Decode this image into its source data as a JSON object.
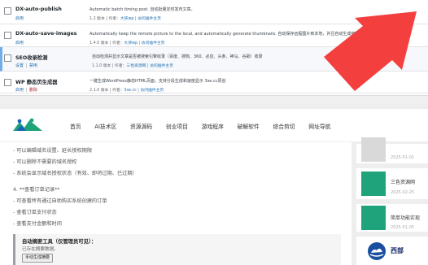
{
  "plugins": [
    {
      "name": "DX-auto-publish",
      "actions": [
        "启用"
      ],
      "description": "Automatic batch timing post. 自动批量定时发布文章。",
      "version": "1.2 版本",
      "author_prefix": "作者：",
      "author": "大侠wp",
      "details": "访问插件主页"
    },
    {
      "name": "DX-auto-save-images",
      "actions": [
        "启用"
      ],
      "description": "Automatically keep the remote picture to the local, and automatically generate thumbnails. 自动保存远程图片到本地，并且自动生成缩略图。",
      "version": "1.4.0 版本",
      "author_prefix": "作者：",
      "author": "大侠wp",
      "details": "访问插件主页"
    },
    {
      "name": "SEO收录检测",
      "actions": [
        "设置",
        "禁用"
      ],
      "description": "自动检测并显示文章是否被搜索引擎收录（百度、搜狗、360、必应、头条、神马、谷歌）收录",
      "version": "1.1.0 版本",
      "author_prefix": "作者：",
      "author": "三色资源网",
      "details": "访问插件主页"
    },
    {
      "name": "WP 静态页生成器",
      "actions": [
        "启用",
        "删除"
      ],
      "description": "一键生成WordPress静态HTML页面，支持分段生成和速度显示 3se.cc原创",
      "version": "2.1.0 版本",
      "author_prefix": "作者：",
      "author": "3se.cc",
      "details": "访问插件主页"
    }
  ],
  "nav": {
    "items": [
      "首页",
      "AI技术区",
      "资源源码",
      "创业项目",
      "游戏程序",
      "破解软件",
      "综合剪切",
      "网址导航"
    ]
  },
  "article": {
    "lines": [
      "- 可以编辑域名设置、延长授权期限",
      "- 可以删除不需要的域名授权",
      "- 系统会显示域名授权状态（有效、即将过期、已过期）",
      "4. **查看订单记录**",
      "- 可查看所有通过自助购买系统创建的订单",
      "- 查看订单支付状态",
      "- 查看支付金额和时间"
    ],
    "box": {
      "title": "自动摘要工具（仅管理员可见）：",
      "status": "已存在摘要数据。",
      "button": "手动生成摘要"
    }
  },
  "sidebar": {
    "cards": [
      {
        "date": "2025-01-01"
      },
      {
        "title": "三色资源网",
        "date": "2025-02-25"
      },
      {
        "title": "简单功能实现",
        "date": "2025-01-05"
      }
    ],
    "brand": "西部"
  },
  "colors": {
    "accent": "#2271b1",
    "arrow": "#f43f3f",
    "active_plugin_border": "#72aee6",
    "delete": "#b32d2e"
  }
}
